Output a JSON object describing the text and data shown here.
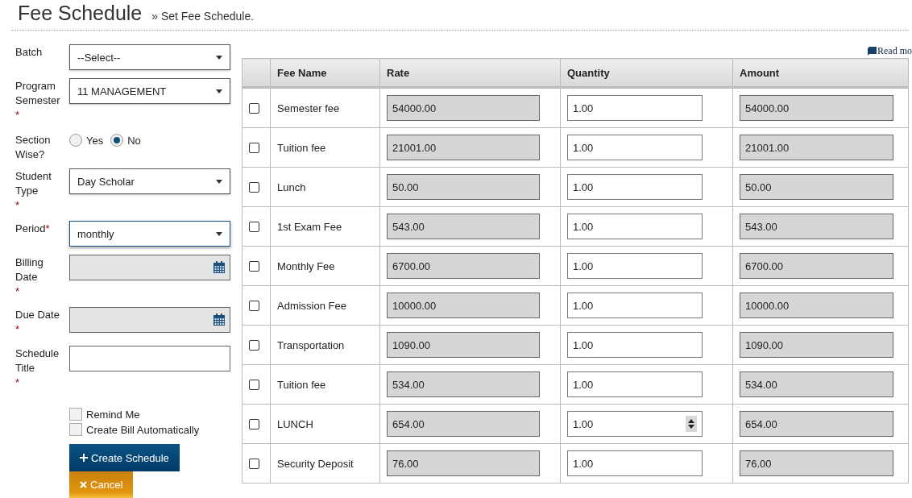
{
  "header": {
    "title": "Fee Schedule",
    "subtitle": "» Set Fee Schedule."
  },
  "form": {
    "fields": [
      {
        "kind": "select",
        "label": "Batch",
        "value": "--Select--",
        "focused": false
      },
      {
        "kind": "select",
        "label": "Program Semester",
        "required_mark": "*",
        "value": "11 MANAGEMENT",
        "focused": false
      },
      {
        "kind": "radio",
        "label": "Section Wise?",
        "options": [
          {
            "label": "Yes",
            "selected": false
          },
          {
            "label": "No",
            "selected": true
          }
        ]
      },
      {
        "kind": "select",
        "label": "Student Type",
        "required_mark": "*",
        "value": "Day Scholar",
        "focused": false
      },
      {
        "kind": "select",
        "label": "Period",
        "label_mark": "*",
        "value": "monthly",
        "focused": true
      },
      {
        "kind": "date",
        "label": "Billing Date",
        "required_mark": "*"
      },
      {
        "kind": "date",
        "label": "Due Date",
        "required_mark": "*"
      },
      {
        "kind": "text",
        "label": "Schedule Title",
        "required_mark": "*"
      }
    ],
    "checkboxes": [
      {
        "label": "Remind Me",
        "checked": false
      },
      {
        "label": "Create Bill Automatically",
        "checked": false
      }
    ],
    "buttons": [
      {
        "kind": "primary",
        "label": "Create Schedule"
      },
      {
        "kind": "cancel",
        "label": "Cancel"
      }
    ]
  },
  "read_more": "Read mo",
  "table": {
    "columns": [
      "Fee Name",
      "Rate",
      "Quantity",
      "Amount"
    ],
    "rows": [
      {
        "checked": false,
        "name": "Semester fee",
        "rate": "54000.00",
        "quantity": "1.00",
        "amount": "54000.00",
        "spinner": false
      },
      {
        "checked": false,
        "name": "Tuition fee",
        "rate": "21001.00",
        "quantity": "1.00",
        "amount": "21001.00",
        "spinner": false
      },
      {
        "checked": false,
        "name": "Lunch",
        "rate": "50.00",
        "quantity": "1.00",
        "amount": "50.00",
        "spinner": false
      },
      {
        "checked": false,
        "name": "1st Exam Fee",
        "rate": "543.00",
        "quantity": "1.00",
        "amount": "543.00",
        "spinner": false
      },
      {
        "checked": false,
        "name": "Monthly Fee",
        "rate": "6700.00",
        "quantity": "1.00",
        "amount": "6700.00",
        "spinner": false
      },
      {
        "checked": false,
        "name": "Admission Fee",
        "rate": "10000.00",
        "quantity": "1.00",
        "amount": "10000.00",
        "spinner": false
      },
      {
        "checked": false,
        "name": "Transportation",
        "rate": "1090.00",
        "quantity": "1.00",
        "amount": "1090.00",
        "spinner": false
      },
      {
        "checked": false,
        "name": "Tuition fee",
        "rate": "534.00",
        "quantity": "1.00",
        "amount": "534.00",
        "spinner": false
      },
      {
        "checked": false,
        "name": "LUNCH",
        "rate": "654.00",
        "quantity": "1.00",
        "amount": "654.00",
        "spinner": true
      },
      {
        "checked": false,
        "name": "Security Deposit",
        "rate": "76.00",
        "quantity": "1.00",
        "amount": "76.00",
        "spinner": false
      }
    ]
  }
}
